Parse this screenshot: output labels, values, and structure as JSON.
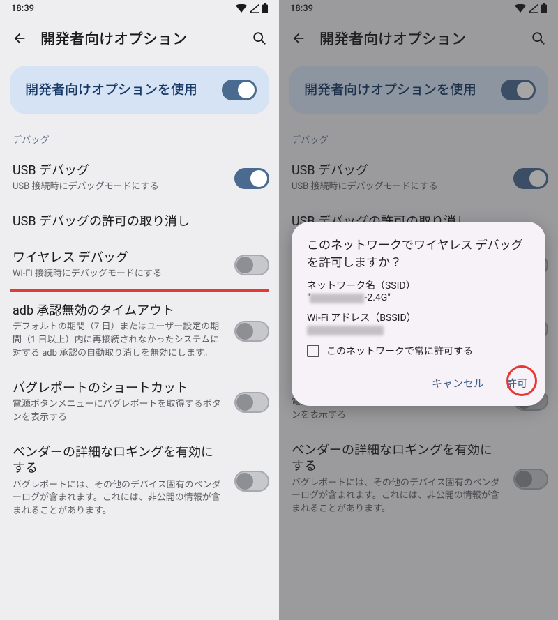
{
  "status": {
    "time": "18:39"
  },
  "app_bar": {
    "title": "開発者向けオプション"
  },
  "master_toggle": {
    "label": "開発者向けオプションを使用",
    "on": "true"
  },
  "section": {
    "debug": "デバッグ"
  },
  "settings": {
    "usb_debug": {
      "title": "USB デバッグ",
      "sub": "USB 接続時にデバッグモードにする"
    },
    "usb_revoke": {
      "title": "USB デバッグの許可の取り消し"
    },
    "wireless": {
      "title": "ワイヤレス デバッグ",
      "sub": "Wi-Fi 接続時にデバッグモードにする"
    },
    "adb_timeout": {
      "title": "adb 承認無効のタイムアウト",
      "sub": "デフォルトの期間（7 日）またはユーザー設定の期間（1 日以上）内に再接続されなかったシステムに対する adb 承認の自動取り消しを無効にします。"
    },
    "bugreport": {
      "title": "バグレポートのショートカット",
      "sub": "電源ボタンメニューにバグレポートを取得するボタンを表示する"
    },
    "vendorlog": {
      "title": "ベンダーの詳細なロギングを有効にする",
      "sub": "バグレポートには、その他のデバイス固有のベンダーログが含まれます。これには、非公開の情報が含まれることがあります。"
    }
  },
  "dialog": {
    "title": "このネットワークでワイヤレス デバッグを許可しますか？",
    "ssid_label": "ネットワーク名（SSID）",
    "ssid_suffix": "-2.4G",
    "bssid_label": "Wi-Fi アドレス（BSSID）",
    "always": "このネットワークで常に許可する",
    "cancel": "キャンセル",
    "allow": "許可"
  }
}
